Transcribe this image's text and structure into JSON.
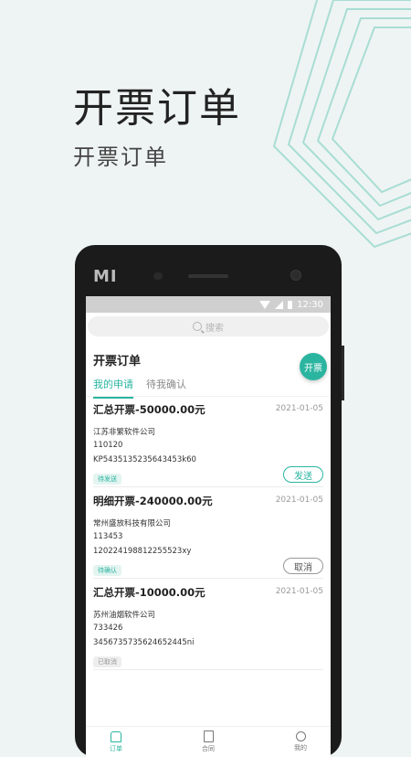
{
  "colors": {
    "accent": "#2bb5a0",
    "background": "#eef4f3",
    "text_dark": "#222222"
  },
  "hero": {
    "title": "开票订单",
    "subtitle": "开票订单"
  },
  "phone": {
    "brand_mark": "MI",
    "status_bar": {
      "time": "12:30"
    },
    "search": {
      "placeholder": "搜索",
      "icon": "search-icon"
    },
    "page": {
      "title": "开票订单",
      "fab_label": "开票",
      "tabs": [
        {
          "label": "我的申请",
          "active": true
        },
        {
          "label": "待我确认",
          "active": false
        }
      ]
    },
    "orders": [
      {
        "title": "汇总开票-50000.00元",
        "date": "2021-01-05",
        "company": "江苏非繁软件公司",
        "code": "110120",
        "number": "KP5435135235643453k60",
        "status": "待发送",
        "action": "发送"
      },
      {
        "title": "明细开票-240000.00元",
        "date": "2021-01-05",
        "company": "常州盛放科技有限公司",
        "code": "113453",
        "number": "120224198812255523xy",
        "status": "待确认",
        "action": "取消"
      },
      {
        "title": "汇总开票-10000.00元",
        "date": "2021-01-05",
        "company": "苏州油烟软件公司",
        "code": "733426",
        "number": "345673573562465​2445ni",
        "status": "已取消",
        "action": ""
      }
    ],
    "bottom_nav": [
      {
        "label": "订单",
        "icon": "order-icon",
        "active": true
      },
      {
        "label": "合同",
        "icon": "contract-icon",
        "active": false
      },
      {
        "label": "我的",
        "icon": "profile-icon",
        "active": false
      }
    ]
  }
}
